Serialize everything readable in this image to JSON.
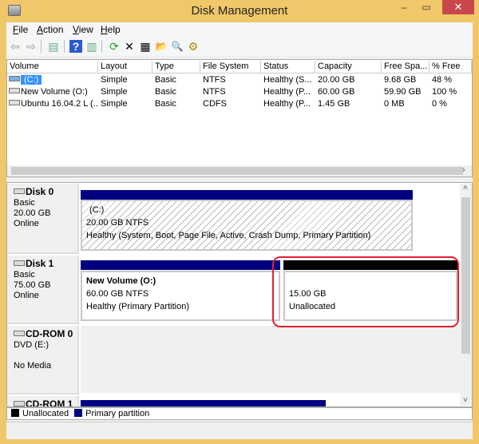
{
  "window": {
    "title": "Disk Management",
    "minimize": "‒",
    "maximize": "▭",
    "close": "✕"
  },
  "menu": [
    "File",
    "Action",
    "View",
    "Help"
  ],
  "toolbar": [
    {
      "icon": "back-icon",
      "g": "⇦"
    },
    {
      "icon": "forward-icon",
      "g": "⇨"
    },
    {
      "icon": "show-hide-console-tree-icon",
      "g": "▤"
    },
    {
      "icon": "help-icon",
      "g": "?"
    },
    {
      "icon": "action-pane-icon",
      "g": "▥"
    },
    {
      "icon": "refresh-icon",
      "g": "⟳"
    },
    {
      "icon": "delete-icon",
      "g": "✕"
    },
    {
      "icon": "properties-icon",
      "g": "▦"
    },
    {
      "icon": "open-icon",
      "g": "📂"
    },
    {
      "icon": "explore-icon",
      "g": "🔍"
    },
    {
      "icon": "settings-icon",
      "g": "⚙"
    }
  ],
  "volumes": {
    "columns": [
      "Volume",
      "Layout",
      "Type",
      "File System",
      "Status",
      "Capacity",
      "Free Spa...",
      "% Free"
    ],
    "rows": [
      [
        "(C:)",
        "Simple",
        "Basic",
        "NTFS",
        "Healthy (S...",
        "20.00 GB",
        "9.68 GB",
        "48 %"
      ],
      [
        "New Volume (O:)",
        "Simple",
        "Basic",
        "NTFS",
        "Healthy (P...",
        "60.00 GB",
        "59.90 GB",
        "100 %"
      ],
      [
        "Ubuntu 16.04.2 L (...",
        "Simple",
        "Basic",
        "CDFS",
        "Healthy (P...",
        "1.45 GB",
        "0 MB",
        "0 %"
      ]
    ]
  },
  "disks": [
    {
      "name": "Disk 0",
      "type": "Basic",
      "size": "20.00 GB",
      "state": "Online",
      "partitions": [
        {
          "title": "(C:)",
          "size": "20.00 GB NTFS",
          "status": "Healthy (System, Boot, Page File, Active, Crash Dump, Primary Partition)"
        }
      ]
    },
    {
      "name": "Disk 1",
      "type": "Basic",
      "size": "75.00 GB",
      "state": "Online",
      "partitions": [
        {
          "title": "New Volume  (O:)",
          "size": "60.00 GB NTFS",
          "status": "Healthy (Primary Partition)"
        },
        {
          "size": "15.00 GB",
          "status": "Unallocated"
        }
      ]
    },
    {
      "name": "CD-ROM 0",
      "type": "DVD (E:)",
      "state": "No Media"
    },
    {
      "name": "CD-ROM 1"
    }
  ],
  "legend": [
    {
      "label": "Unallocated",
      "color": "#000000"
    },
    {
      "label": "Primary partition",
      "color": "#000080"
    }
  ],
  "colors": {
    "primary": "#000080",
    "unallocated": "#000000",
    "frame": "#f0c86a",
    "highlight": "#e02030"
  }
}
